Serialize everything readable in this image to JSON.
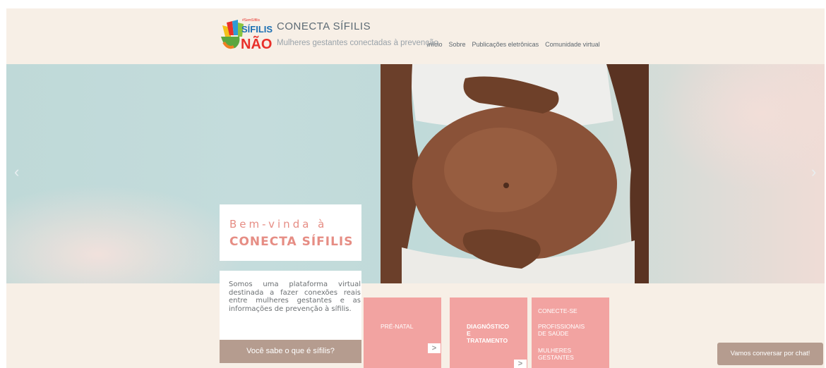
{
  "header": {
    "brand_title": "CONECTA SÍFILIS",
    "brand_tagline": "Mulheres gestantes conectadas à prevenção",
    "logo_text_top": "SÍFILIS",
    "logo_text_bottom": "NÃO"
  },
  "nav": {
    "items": [
      {
        "label": "Início"
      },
      {
        "label": "Sobre"
      },
      {
        "label": "Publicações eletrônicas"
      },
      {
        "label": "Comunidade virtual"
      }
    ]
  },
  "hero": {
    "welcome_line1": "Bem-vinda à",
    "welcome_line2": "CONECTA SÍFILIS",
    "description": "Somos uma plataforma virtual destinada a fazer conexões reais entre mulheres gestantes e as informações de prevenção à sífilis.",
    "cta_label": "Você sabe o que é sífilis?",
    "arrow_left": "‹",
    "arrow_right": "›"
  },
  "tiles": {
    "prenatal": {
      "label": "PRÉ-NATAL",
      "arrow": ">"
    },
    "diagnostico": {
      "line1": "DIAGNÓSTICO",
      "line2": "E",
      "line3": "TRATAMENTO",
      "arrow": ">"
    },
    "conecte": {
      "title": "CONECTE-SE",
      "item1": "PROFISSIONAIS DE SAÚDE",
      "item2": "MULHERES GESTANTES"
    }
  },
  "chat": {
    "label": "Vamos conversar por chat!"
  },
  "colors": {
    "accent": "#f2a3a1",
    "brand_text": "#e68d84",
    "button": "#b59c8f",
    "background": "#f7efe6"
  }
}
